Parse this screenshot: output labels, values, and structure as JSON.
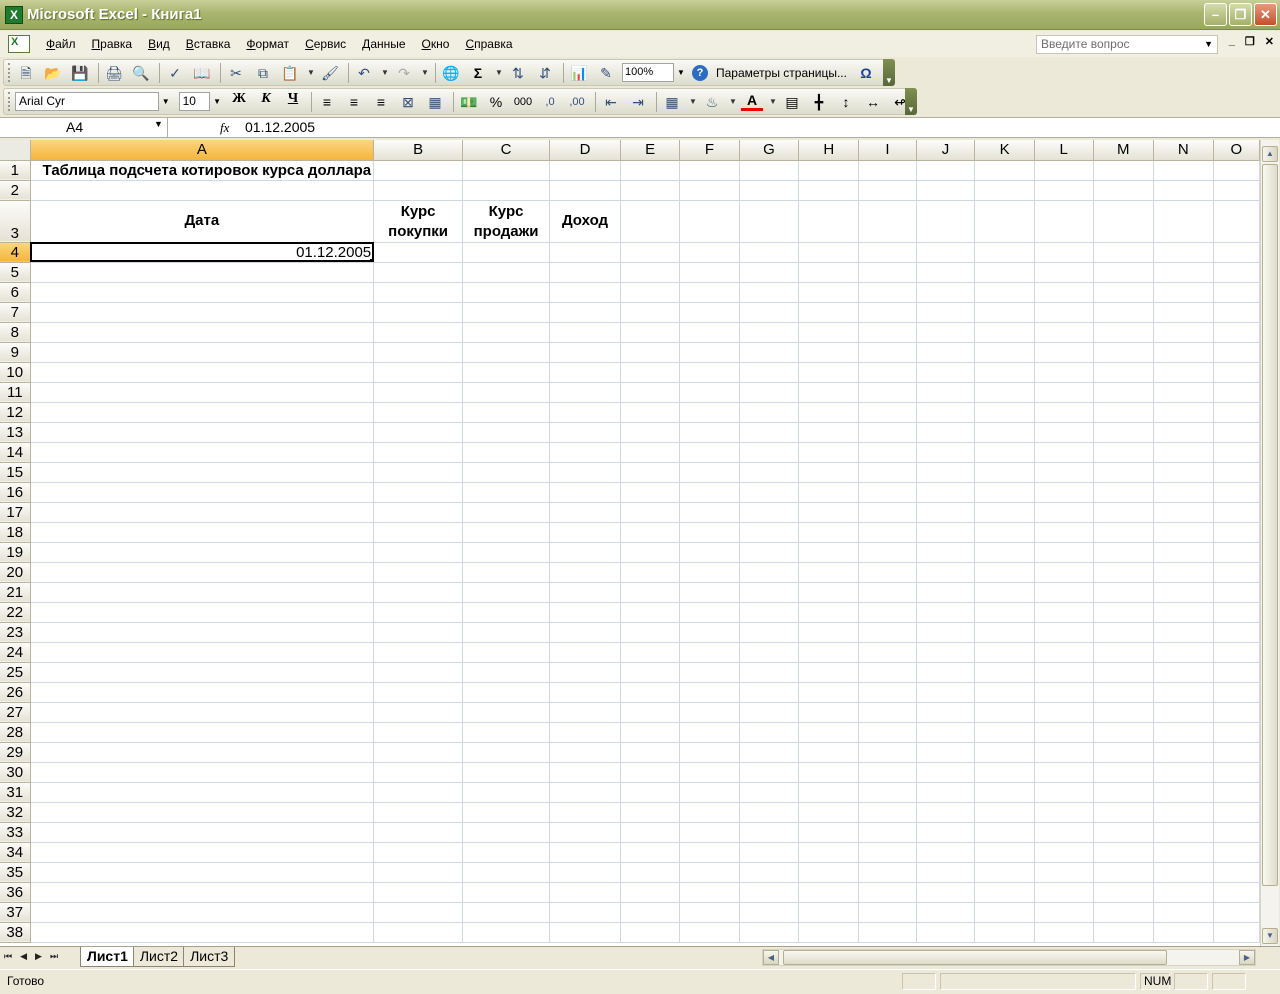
{
  "window": {
    "title": "Microsoft Excel - Книга1",
    "app_icon_letter": "X"
  },
  "menu": {
    "items": [
      "Файл",
      "Правка",
      "Вид",
      "Вставка",
      "Формат",
      "Сервис",
      "Данные",
      "Окно",
      "Справка"
    ],
    "help_placeholder": "Введите вопрос"
  },
  "toolbar_standard": {
    "zoom": "100%",
    "page_setup_label": "Параметры страницы...",
    "sum_symbol": "Σ",
    "omega_symbol": "Ω"
  },
  "toolbar_format": {
    "font_name": "Arial Cyr",
    "font_size": "10",
    "bold": "Ж",
    "italic": "К",
    "underline": "Ч",
    "percent": "%",
    "thousands": "000",
    "font_color_letter": "A"
  },
  "formula_bar": {
    "name_box": "A4",
    "fx": "fx",
    "formula": "01.12.2005"
  },
  "grid": {
    "columns": [
      "A",
      "B",
      "C",
      "D",
      "E",
      "F",
      "G",
      "H",
      "I",
      "J",
      "K",
      "L",
      "M",
      "N",
      "O"
    ],
    "active_column": "A",
    "active_row": 4,
    "title": "Таблица подсчета котировок курса доллара",
    "headers": {
      "date": "Дата",
      "buy_rate": "Курс покупки",
      "sell_rate": "Курс продажи",
      "income": "Доход"
    },
    "a4_value": "01.12.2005",
    "row_count": 38
  },
  "sheets": {
    "tabs": [
      "Лист1",
      "Лист2",
      "Лист3"
    ],
    "active": "Лист1"
  },
  "status": {
    "ready": "Готово",
    "num": "NUM"
  },
  "colors": {
    "title_bar": "#a9b56e",
    "active_header": "#f5b53d",
    "gridline": "#d0d7e5",
    "close_button": "#c4502c"
  }
}
